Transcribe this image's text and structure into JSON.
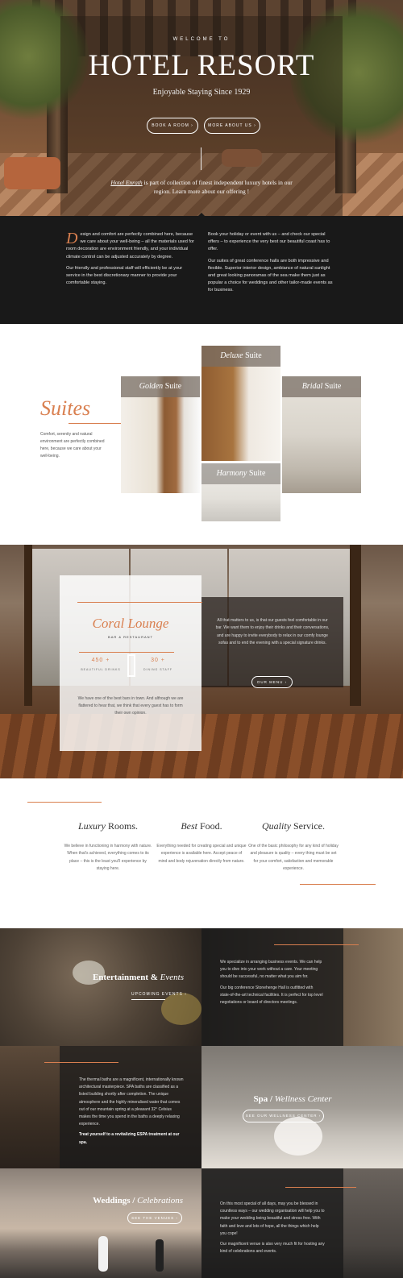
{
  "hero": {
    "welcome": "WELCOME TO",
    "title": "HOTEL RESORT",
    "subtitle": "Enjoyable Staying Since 1929",
    "btn_book": "BOOK A ROOM  ›",
    "btn_more": "MORE ABOUT US  ›",
    "note_brand": "Hotel Enrath",
    "note_rest": " is part of collection of finest independent luxury hotels in our region. Learn more about our offering !"
  },
  "intro": {
    "dropcap": "D",
    "left_p1": "esign and comfort are perfectly combined here, because we care about your well-being – all the materials used for room decoration are environment friendly, and your individual climate control can be adjusted accurately by degree.",
    "left_p2": "Our friendly and professional staff will efficiently be at your service in the best discretionary  manner to provide your comfortable staying.",
    "right_p1": "Book your holiday or event with us – and check our special offers – to experience the very best our beautiful coast has to offer.",
    "right_p2": "Our suites of great conference halls are both impressive and flexible. Superior interior design, ambiance of natural sunlight and great looking panoramas of the sea make them just as popular a choice for weddings and other tailor-made events as for business."
  },
  "suites": {
    "title": "Suites",
    "text": "Comfort, serenity and natural environment are perfectly combined here, because we care about your well-being.",
    "items": [
      {
        "em": "Golden",
        "rest": " Suite"
      },
      {
        "em": "Deluxe",
        "rest": " Suite"
      },
      {
        "em": "Bridal",
        "rest": " Suite"
      },
      {
        "em": "Harmony",
        "rest": " Suite"
      }
    ]
  },
  "coral": {
    "title": "Coral Lounge",
    "sub": "BAR & RESTAURANT",
    "stat1_num": "450 +",
    "stat1_label": "BEAUTIFUL DRINKS",
    "stat2_num": "30 +",
    "stat2_label": "DINING STAFF",
    "text": "We have one of the best bars in town. And although we are flattered to hear that, we think that every guest has to form their own opinion.",
    "right_text": "All that matters to us, is that our guests feel comfortable in our bar. We want them to enjoy their drinks and their conversations, and are happy to invite everybody to relax in our comfy lounge sofas and to end the evening with a special signature drinks.",
    "btn": "OUR MENU  ›"
  },
  "features": [
    {
      "em": "Luxury",
      "rest": " Rooms.",
      "text": "We believe in functioning in harmony with nature. When that's achieved, everything comes to its place – this is the least you'll experience by staying here."
    },
    {
      "em": "Best",
      "rest": " Food.",
      "text": "Everything needed for creating special and unique experience is available here. Accept peace of mind and body rejuvenation directly from nature."
    },
    {
      "em": "Quality",
      "rest": " Service.",
      "text": "One of the basic philosophy for any kind of holiday and pleasure is quality – every thing must be set for your comfort, satisfaction and memorable experience."
    }
  ],
  "entertainment": {
    "title_a": "Entertainment & ",
    "title_b": "Events",
    "link": "UPCOMING EVENTS  ›",
    "p1": "We specialize in arranging business events. We can help you to dive into your work without a care. Your meeting should be successful, no matter what you aim for.",
    "p2": "Our big conference Stonehenge Hall is outfitted with state-of-the-art technical facilities. It is perfect for top level negotiations or board of directors meetings."
  },
  "spa": {
    "text": "The thermal baths are a magnificent, internationally known architectural masterpiece. SPA baths are classified as a listed building shortly after completion. The unique atmosphere and the highly mineralised water that comes out of our mountain spring at a pleasant 32° Celsius makes the time you spend in the baths a deeply relaxing experience.",
    "bold": "Treat yourself to a revitalizing ESPA treatment at our spa.",
    "title_a": "Spa / ",
    "title_b": "Wellness Center",
    "btn": "SEE OUR WELLNESS CENTER  ›"
  },
  "weddings": {
    "title_a": "Weddings / ",
    "title_b": "Celebrations",
    "btn": "SEE THE VENUES  ›",
    "p1": "On this most special of all days, may you be blessed in countless ways – our wedding organisation will help you to make your wedding being beautiful and stress free. With faith and love and lots of hope, all the things which help you cope!",
    "p2": "Our magnificent venue is also very much fit for hosting any kind of  celebrations and events."
  },
  "colors": {
    "accent": "#d97f4f",
    "dark": "#191919"
  }
}
